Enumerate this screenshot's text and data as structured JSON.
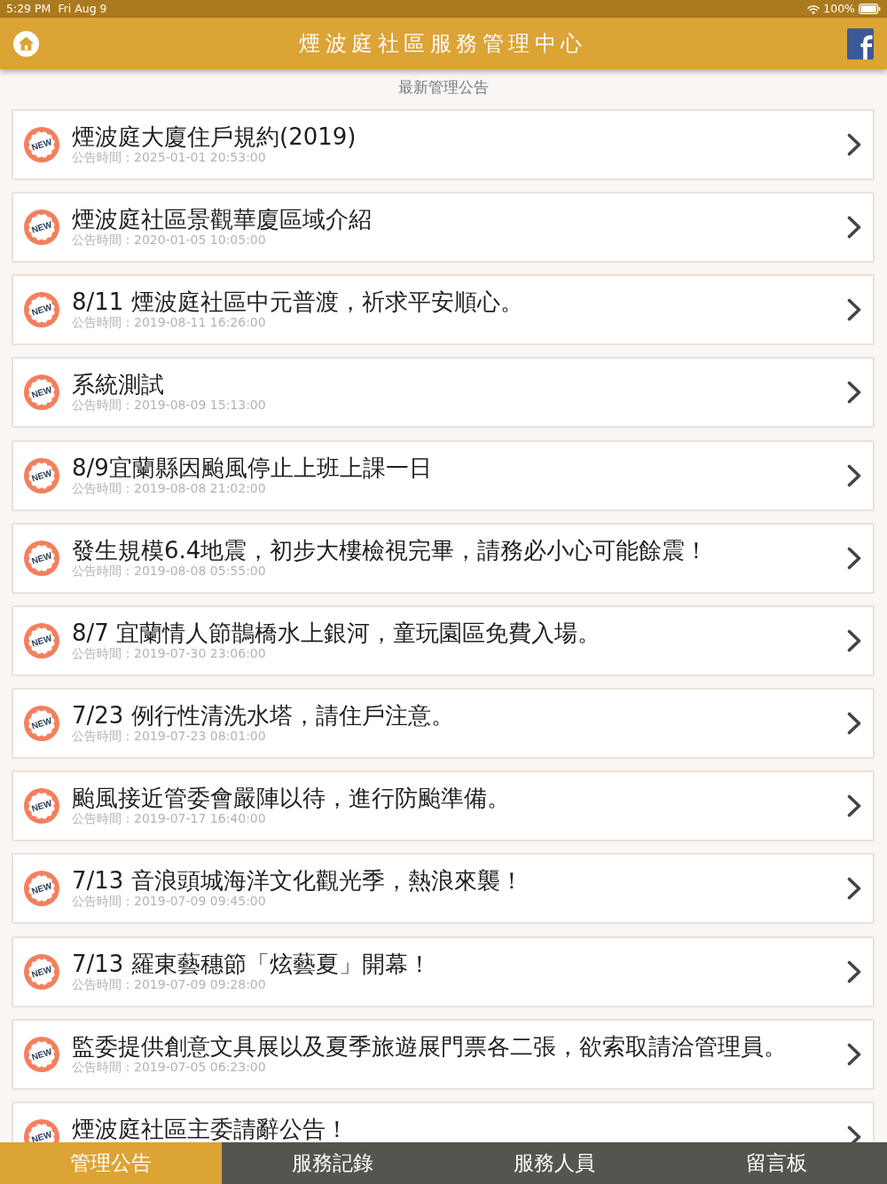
{
  "status_bar": {
    "time": "5:29 PM",
    "date": "Fri Aug 9",
    "battery": "100%"
  },
  "header": {
    "title": "煙波庭社區服務管理中心"
  },
  "section_title": "最新管理公告",
  "announcements": [
    {
      "badge": "NEW",
      "title": "煙波庭大廈住戶規約(2019)",
      "posted": "公告時間：2025-01-01 20:53:00"
    },
    {
      "badge": "NEW",
      "title": "煙波庭社區景觀華廈區域介紹",
      "posted": "公告時間：2020-01-05 10:05:00"
    },
    {
      "badge": "NEW",
      "title": "8/11 煙波庭社區中元普渡，祈求平安順心。",
      "posted": "公告時間：2019-08-11 16:26:00"
    },
    {
      "badge": "NEW",
      "title": "系統測試",
      "posted": "公告時間：2019-08-09 15:13:00"
    },
    {
      "badge": "NEW",
      "title": "8/9宜蘭縣因颱風停止上班上課一日",
      "posted": "公告時間：2019-08-08 21:02:00"
    },
    {
      "badge": "NEW",
      "title": "發生規模6.4地震，初步大樓檢視完畢，請務必小心可能餘震！",
      "posted": "公告時間：2019-08-08 05:55:00"
    },
    {
      "badge": "NEW",
      "title": "8/7 宜蘭情人節鵲橋水上銀河，童玩園區免費入場。",
      "posted": "公告時間：2019-07-30 23:06:00"
    },
    {
      "badge": "NEW",
      "title": "7/23 例行性清洗水塔，請住戶注意。",
      "posted": "公告時間：2019-07-23 08:01:00"
    },
    {
      "badge": "NEW",
      "title": "颱風接近管委會嚴陣以待，進行防颱準備。",
      "posted": "公告時間：2019-07-17 16:40:00"
    },
    {
      "badge": "NEW",
      "title": "7/13 音浪頭城海洋文化觀光季，熱浪來襲！",
      "posted": "公告時間：2019-07-09 09:45:00"
    },
    {
      "badge": "NEW",
      "title": "7/13 羅東藝穗節「炫藝夏」開幕！",
      "posted": "公告時間：2019-07-09 09:28:00"
    },
    {
      "badge": "NEW",
      "title": "監委提供創意文具展以及夏季旅遊展門票各二張，欲索取請洽管理員。",
      "posted": "公告時間：2019-07-05 06:23:00"
    },
    {
      "badge": "NEW",
      "title": "煙波庭社區主委請辭公告！"
    }
  ],
  "tab_bar": [
    {
      "label": "管理公告",
      "selected": true
    },
    {
      "label": "服務記錄",
      "selected": false
    },
    {
      "label": "服務人員",
      "selected": false
    },
    {
      "label": "留言板",
      "selected": false
    }
  ]
}
